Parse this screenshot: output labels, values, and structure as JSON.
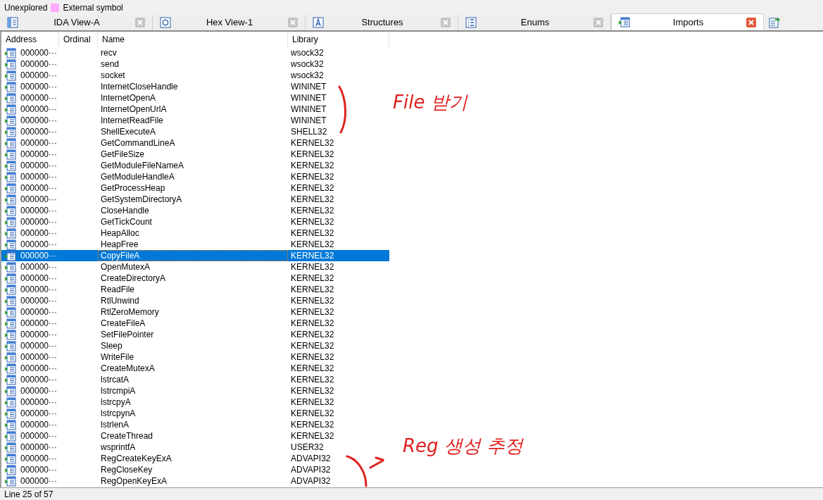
{
  "legend": [
    {
      "label": "Unexplored"
    },
    {
      "label": "External symbol",
      "color": "#ffaaff"
    }
  ],
  "tabs": [
    {
      "label": "IDA View-A",
      "kind": "view",
      "selected": false
    },
    {
      "label": "Hex View-1",
      "kind": "hex",
      "selected": false
    },
    {
      "label": "Structures",
      "kind": "struct",
      "selected": false
    },
    {
      "label": "Enums",
      "kind": "enum",
      "selected": false
    },
    {
      "label": "Imports",
      "kind": "imports",
      "selected": true
    }
  ],
  "table": {
    "columns": [
      "Address",
      "Ordinal",
      "Name",
      "Library"
    ],
    "rows": [
      {
        "address": "000000···",
        "name": "recv",
        "library": "wsock32",
        "selected": false
      },
      {
        "address": "000000···",
        "name": "send",
        "library": "wsock32",
        "selected": false
      },
      {
        "address": "000000···",
        "name": "socket",
        "library": "wsock32",
        "selected": false
      },
      {
        "address": "000000···",
        "name": "InternetCloseHandle",
        "library": "WININET",
        "selected": false
      },
      {
        "address": "000000···",
        "name": "InternetOpenA",
        "library": "WININET",
        "selected": false
      },
      {
        "address": "000000···",
        "name": "InternetOpenUrlA",
        "library": "WININET",
        "selected": false
      },
      {
        "address": "000000···",
        "name": "InternetReadFile",
        "library": "WININET",
        "selected": false
      },
      {
        "address": "000000···",
        "name": "ShellExecuteA",
        "library": "SHELL32",
        "selected": false
      },
      {
        "address": "000000···",
        "name": "GetCommandLineA",
        "library": "KERNEL32",
        "selected": false
      },
      {
        "address": "000000···",
        "name": "GetFileSize",
        "library": "KERNEL32",
        "selected": false
      },
      {
        "address": "000000···",
        "name": "GetModuleFileNameA",
        "library": "KERNEL32",
        "selected": false
      },
      {
        "address": "000000···",
        "name": "GetModuleHandleA",
        "library": "KERNEL32",
        "selected": false
      },
      {
        "address": "000000···",
        "name": "GetProcessHeap",
        "library": "KERNEL32",
        "selected": false
      },
      {
        "address": "000000···",
        "name": "GetSystemDirectoryA",
        "library": "KERNEL32",
        "selected": false
      },
      {
        "address": "000000···",
        "name": "CloseHandle",
        "library": "KERNEL32",
        "selected": false
      },
      {
        "address": "000000···",
        "name": "GetTickCount",
        "library": "KERNEL32",
        "selected": false
      },
      {
        "address": "000000···",
        "name": "HeapAlloc",
        "library": "KERNEL32",
        "selected": false
      },
      {
        "address": "000000···",
        "name": "HeapFree",
        "library": "KERNEL32",
        "selected": false
      },
      {
        "address": "000000···",
        "name": "CopyFileA",
        "library": "KERNEL32",
        "selected": true
      },
      {
        "address": "000000···",
        "name": "OpenMutexA",
        "library": "KERNEL32",
        "selected": false
      },
      {
        "address": "000000···",
        "name": "CreateDirectoryA",
        "library": "KERNEL32",
        "selected": false
      },
      {
        "address": "000000···",
        "name": "ReadFile",
        "library": "KERNEL32",
        "selected": false
      },
      {
        "address": "000000···",
        "name": "RtlUnwind",
        "library": "KERNEL32",
        "selected": false
      },
      {
        "address": "000000···",
        "name": "RtlZeroMemory",
        "library": "KERNEL32",
        "selected": false
      },
      {
        "address": "000000···",
        "name": "CreateFileA",
        "library": "KERNEL32",
        "selected": false
      },
      {
        "address": "000000···",
        "name": "SetFilePointer",
        "library": "KERNEL32",
        "selected": false
      },
      {
        "address": "000000···",
        "name": "Sleep",
        "library": "KERNEL32",
        "selected": false
      },
      {
        "address": "000000···",
        "name": "WriteFile",
        "library": "KERNEL32",
        "selected": false
      },
      {
        "address": "000000···",
        "name": "CreateMutexA",
        "library": "KERNEL32",
        "selected": false
      },
      {
        "address": "000000···",
        "name": "lstrcatA",
        "library": "KERNEL32",
        "selected": false
      },
      {
        "address": "000000···",
        "name": "lstrcmpiA",
        "library": "KERNEL32",
        "selected": false
      },
      {
        "address": "000000···",
        "name": "lstrcpyA",
        "library": "KERNEL32",
        "selected": false
      },
      {
        "address": "000000···",
        "name": "lstrcpynA",
        "library": "KERNEL32",
        "selected": false
      },
      {
        "address": "000000···",
        "name": "lstrlenA",
        "library": "KERNEL32",
        "selected": false
      },
      {
        "address": "000000···",
        "name": "CreateThread",
        "library": "KERNEL32",
        "selected": false
      },
      {
        "address": "000000···",
        "name": "wsprintfA",
        "library": "USER32",
        "selected": false
      },
      {
        "address": "000000···",
        "name": "RegCreateKeyExA",
        "library": "ADVAPI32",
        "selected": false
      },
      {
        "address": "000000···",
        "name": "RegCloseKey",
        "library": "ADVAPI32",
        "selected": false
      },
      {
        "address": "000000···",
        "name": "RegOpenKeyExA",
        "library": "ADVAPI32",
        "selected": false
      }
    ]
  },
  "annotations": [
    {
      "text": "File 받기"
    },
    {
      "text": "Reg 생성 추정"
    }
  ],
  "status_bar": "Line 25 of 57"
}
